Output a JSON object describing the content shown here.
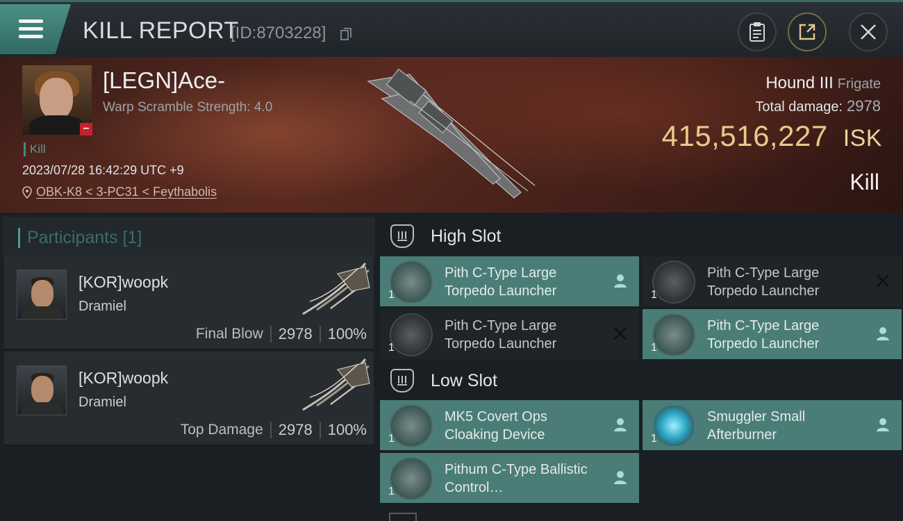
{
  "header": {
    "title": "KILL REPORT",
    "report_id": "[ID:8703228]"
  },
  "victim": {
    "name": "[LEGN]Ace-",
    "scramble": "Warp Scramble Strength: 4.0",
    "tag": "Kill",
    "datetime": "2023/07/28 16:42:29 UTC +9",
    "location": "OBK-K8 < 3-PC31 < Feythabolis",
    "ship_name": "Hound III",
    "ship_class": "Frigate",
    "total_damage_label": "Total damage:",
    "total_damage": "2978",
    "isk_value": "415,516,227",
    "isk_unit": "ISK",
    "outcome": "Kill"
  },
  "participants": {
    "heading": "Participants [1]",
    "rows": [
      {
        "name": "[KOR]woopk",
        "ship": "Dramiel",
        "role": "Final Blow",
        "damage": "2978",
        "percent": "100%"
      },
      {
        "name": "[KOR]woopk",
        "ship": "Dramiel",
        "role": "Top Damage",
        "damage": "2978",
        "percent": "100%"
      }
    ]
  },
  "fitting": {
    "high_slot": {
      "title": "High Slot",
      "modules": [
        {
          "name": "Pith C-Type Large Torpedo Launcher",
          "qty": "1",
          "state": "on",
          "icon": "torpedo-launcher-icon",
          "status_icon": "pilot-icon"
        },
        {
          "name": "Pith C-Type Large Torpedo Launcher",
          "qty": "1",
          "state": "off",
          "icon": "torpedo-launcher-icon",
          "status_icon": "destroyed-x-icon"
        },
        {
          "name": "Pith C-Type Large Torpedo Launcher",
          "qty": "1",
          "state": "off",
          "icon": "torpedo-launcher-icon",
          "status_icon": "destroyed-x-icon"
        },
        {
          "name": "Pith C-Type Large Torpedo Launcher",
          "qty": "1",
          "state": "on",
          "icon": "torpedo-launcher-icon",
          "status_icon": "pilot-icon"
        }
      ]
    },
    "low_slot": {
      "title": "Low Slot",
      "modules": [
        {
          "name": "MK5 Covert Ops Cloaking Device",
          "qty": "1",
          "state": "on",
          "icon": "cloaking-device-icon",
          "status_icon": "pilot-icon"
        },
        {
          "name": "Smuggler Small Afterburner",
          "qty": "1",
          "state": "on",
          "icon": "afterburner-icon",
          "status_icon": "pilot-icon"
        },
        {
          "name": "Pithum C-Type Ballistic Control…",
          "qty": "1",
          "state": "on",
          "icon": "ballistic-control-icon",
          "status_icon": "pilot-icon"
        }
      ]
    }
  },
  "colors": {
    "accent_teal": "#4a7d77",
    "isk_gold": "#e9c98a",
    "badge_red": "#c8202a"
  }
}
